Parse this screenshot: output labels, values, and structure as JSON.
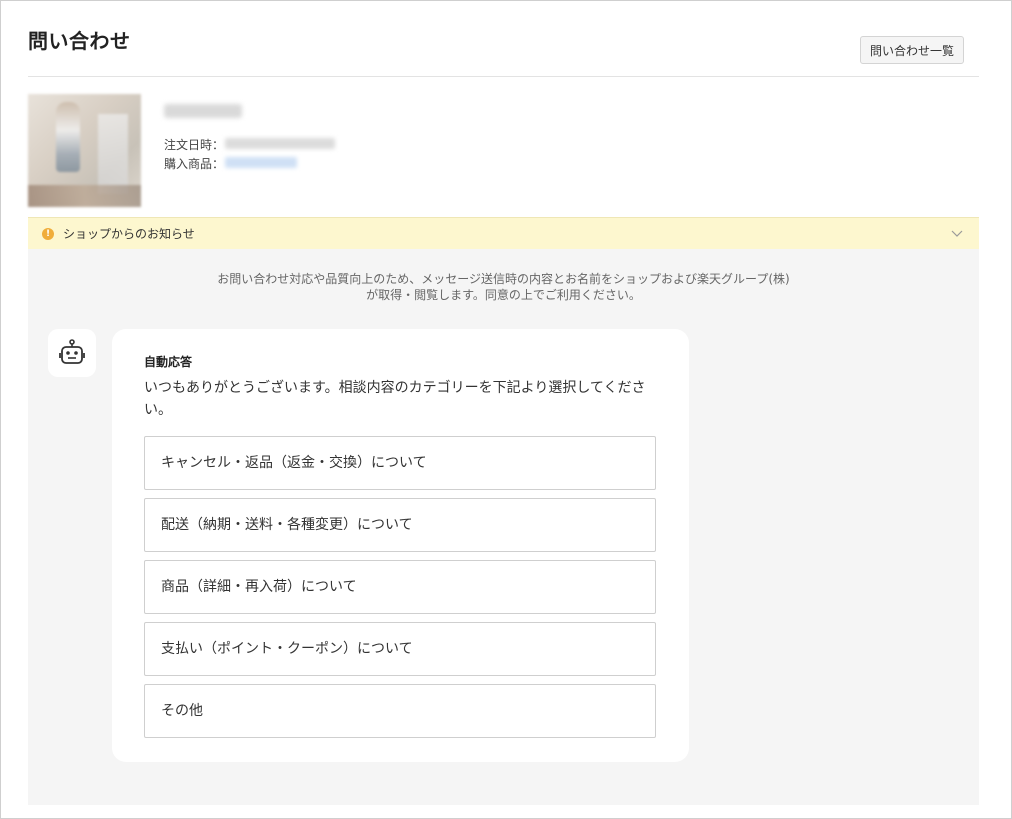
{
  "header": {
    "title": "問い合わせ",
    "list_button": "問い合わせ一覧"
  },
  "order": {
    "shop_name": "",
    "order_date_label": "注文日時：",
    "order_date_value": "",
    "product_label": "購入商品：",
    "product_value": ""
  },
  "notice": {
    "icon": "info-icon",
    "label": "ショップからのお知らせ",
    "toggle_icon": "chevron-down-icon"
  },
  "chat": {
    "consent_line1": "お問い合わせ対応や品質向上のため、メッセージ送信時の内容とお名前をショップおよび楽天グループ(株)",
    "consent_line2": "が取得・閲覧します。同意の上でご利用ください。",
    "bot_icon": "robot-icon",
    "bubble_title": "自動応答",
    "bubble_message": "いつもありがとうございます。相談内容のカテゴリーを下記より選択してください。",
    "options": [
      "キャンセル・返品（返金・交換）について",
      "配送（納期・送料・各種変更）について",
      "商品（詳細・再入荷）について",
      "支払い（ポイント・クーポン）について",
      "その他"
    ]
  },
  "colors": {
    "notice_bg": "#fdf7cf",
    "notice_icon": "#f0ad3a",
    "chat_bg": "#f5f5f5"
  }
}
